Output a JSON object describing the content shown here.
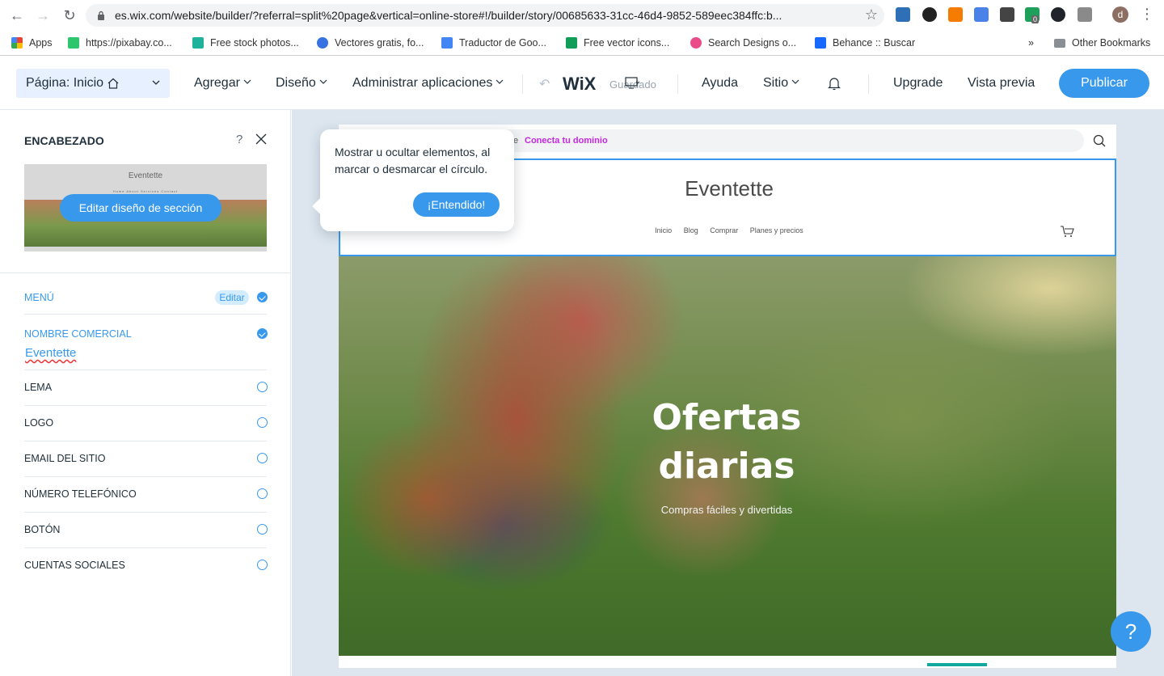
{
  "browser": {
    "url": "es.wix.com/website/builder/?referral=split%20page&vertical=online-store#!/builder/story/00685633-31cc-46d4-9852-589eec384ffc:b...",
    "bookmarks": [
      {
        "label": "Apps"
      },
      {
        "label": "https://pixabay.co..."
      },
      {
        "label": "Free stock photos..."
      },
      {
        "label": "Vectores gratis, fo..."
      },
      {
        "label": "Traductor de Goo..."
      },
      {
        "label": "Free vector icons..."
      },
      {
        "label": "Search Designs o..."
      },
      {
        "label": "Behance :: Buscar"
      }
    ],
    "more_bookmarks": "»",
    "other_bookmarks": "Other Bookmarks",
    "profile_initial": "d",
    "extension_badge": "0"
  },
  "topbar": {
    "page_label": "Página: Inicio",
    "menu": {
      "add": "Agregar",
      "design": "Diseño",
      "apps": "Administrar aplicaciones",
      "help": "Ayuda",
      "site": "Sitio",
      "upgrade": "Upgrade",
      "preview": "Vista previa"
    },
    "logo": "WiX",
    "saved_status": "Guardado",
    "publish": "Publicar"
  },
  "panel": {
    "title": "ENCABEZADO",
    "help_mark": "?",
    "thumb_name": "Eventette",
    "thumb_nav": "Home About Services Contact",
    "edit_layout_button": "Editar diseño de sección",
    "options": [
      {
        "label": "MENÚ",
        "checked": true
      },
      {
        "label": "NOMBRE COMERCIAL",
        "checked": true
      },
      {
        "label": "LEMA",
        "checked": false
      },
      {
        "label": "LOGO",
        "checked": false
      },
      {
        "label": "EMAIL DEL SITIO",
        "checked": false
      },
      {
        "label": "NÚMERO TELEFÓNICO",
        "checked": false
      },
      {
        "label": "BOTÓN",
        "checked": false
      },
      {
        "label": "CUENTAS SOCIALES",
        "checked": false
      }
    ],
    "edit_pill": "Editar",
    "business_name_value": "Eventette"
  },
  "site": {
    "domain_prefix": "e",
    "connect_domain": "Conecta tu dominio",
    "brand": "Eventette",
    "nav": [
      "Inicio",
      "Blog",
      "Comprar",
      "Planes y precios"
    ],
    "hero_title_line1": "Ofertas",
    "hero_title_line2": "diarias",
    "hero_subtitle": "Compras fáciles y divertidas"
  },
  "tooltip": {
    "text": "Mostrar u ocultar elementos, al marcar o desmarcar el círculo.",
    "button": "¡Entendido!"
  },
  "help_fab": "?",
  "colors": {
    "accent": "#3899ec",
    "connect_domain": "#c428e0",
    "strip_indicator": "#12a89e"
  }
}
